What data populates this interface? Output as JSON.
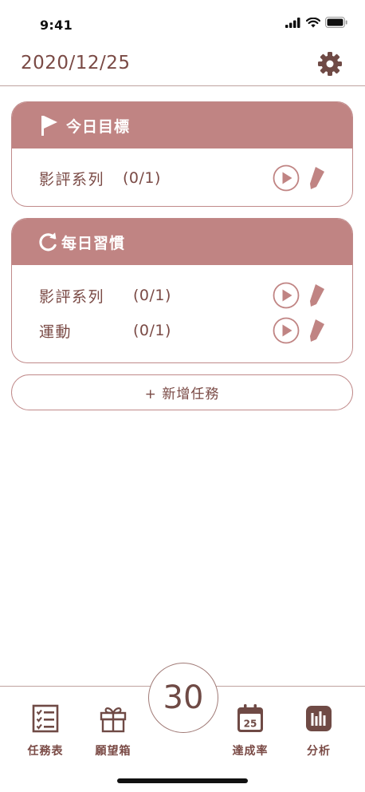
{
  "status_bar": {
    "time": "9:41"
  },
  "header": {
    "date": "2020/12/25",
    "settings_icon": "gear-icon"
  },
  "today_goals": {
    "title": "今日目標",
    "icon": "flag-icon",
    "tasks": [
      {
        "name": "影評系列",
        "progress": "(0/1)"
      }
    ]
  },
  "daily_habits": {
    "title": "每日習慣",
    "icon": "refresh-icon",
    "tasks": [
      {
        "name": "影評系列",
        "progress": "(0/1)"
      },
      {
        "name": "運動",
        "progress": "(0/1)"
      }
    ]
  },
  "add_task_label": "+ 新增任務",
  "timer_value": "30",
  "tabbar": {
    "items": [
      {
        "label": "任務表",
        "icon": "checklist-icon"
      },
      {
        "label": "願望箱",
        "icon": "gift-icon"
      },
      {
        "label": "達成率",
        "icon": "calendar-icon",
        "badge": "25"
      },
      {
        "label": "分析",
        "icon": "bar-chart-icon"
      }
    ]
  },
  "colors": {
    "accent": "#c08483",
    "text": "#7a4a45",
    "border": "#c08a8a"
  }
}
